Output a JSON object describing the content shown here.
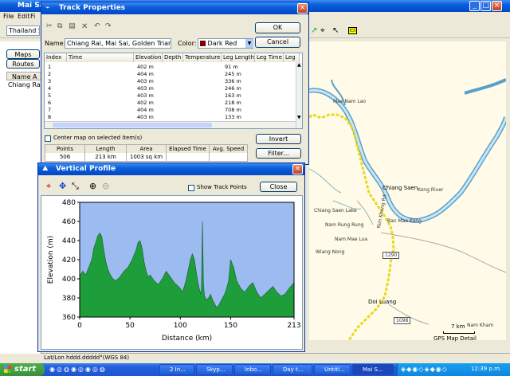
{
  "main_window": {
    "title": "Mai Sai",
    "menu": [
      "File",
      "Edit",
      "Fi"
    ],
    "combo_value": "Thailand St",
    "tabs": [
      "Maps",
      "Routes"
    ],
    "list_header": [
      "Name",
      "A"
    ],
    "list_item": "Chiang Rai",
    "status_latlon": "Lat/Lon hddd.ddddd°(WGS 84)",
    "map_status": "GPS Map Detail",
    "scale": "7 km"
  },
  "map_labels": {
    "chiang_saen": "Chiang Saen",
    "river_road": "Rim Khong Rd",
    "dor_luang": "Doi Luang",
    "road_1098": "1098",
    "road_1290": "1290",
    "lake": "Chiang Saen Lake",
    "place1": "Nam Rung Rung",
    "place2": "Nam Mae Lua",
    "place3": "Wiang Nong",
    "place4": "Ban Mae Kong",
    "place5": "Nam Kham",
    "place6": "Mae Nam Lao",
    "place7": "Kong River"
  },
  "track_properties": {
    "title": "Track Properties",
    "name_label": "Name:",
    "name_value": "Chiang Rai, Mai Sai, Golden Triangle",
    "color_label": "Color:",
    "color_value": "Dark Red",
    "color_swatch": "#800000",
    "ok": "OK",
    "cancel": "Cancel",
    "columns": [
      "Index",
      "Time",
      "Elevation",
      "Depth",
      "Temperature",
      "Leg Length",
      "Leg Time",
      "Leg"
    ],
    "rows": [
      [
        "1",
        "",
        "402 m",
        "",
        "",
        "91 m"
      ],
      [
        "2",
        "",
        "404 m",
        "",
        "",
        "245 m"
      ],
      [
        "3",
        "",
        "403 m",
        "",
        "",
        "336 m"
      ],
      [
        "4",
        "",
        "403 m",
        "",
        "",
        "246 m"
      ],
      [
        "5",
        "",
        "403 m",
        "",
        "",
        "163 m"
      ],
      [
        "6",
        "",
        "402 m",
        "",
        "",
        "218 m"
      ],
      [
        "7",
        "",
        "404 m",
        "",
        "",
        "708 m"
      ],
      [
        "8",
        "",
        "403 m",
        "",
        "",
        "133 m"
      ]
    ],
    "center_map": "Center map on selected item(s)",
    "invert": "Invert",
    "filter": "Filter...",
    "stats_headers": [
      "Points",
      "Length",
      "Area",
      "Elapsed Time",
      "Avg. Speed"
    ],
    "stats_values": [
      "506",
      "213 km",
      "1003 sq km",
      "",
      ""
    ]
  },
  "vertical_profile": {
    "title": "Vertical Profile",
    "show_track_points": "Show Track Points",
    "close": "Close"
  },
  "chart_data": {
    "type": "area",
    "xlabel": "Distance (km)",
    "ylabel": "Elevation (m)",
    "xlim": [
      0,
      213
    ],
    "ylim": [
      360,
      480
    ],
    "x_ticks": [
      0,
      50,
      100,
      150,
      213
    ],
    "y_ticks": [
      360,
      380,
      400,
      420,
      440,
      460,
      480
    ],
    "fill_color": "#1e9e3a",
    "x": [
      0,
      3,
      6,
      9,
      12,
      14,
      16,
      18,
      20,
      22,
      24,
      26,
      28,
      30,
      33,
      36,
      40,
      44,
      48,
      52,
      56,
      58,
      60,
      62,
      64,
      66,
      68,
      70,
      74,
      78,
      82,
      86,
      90,
      94,
      98,
      100,
      102,
      104,
      106,
      108,
      110,
      112,
      114,
      116,
      118,
      120,
      121,
      122,
      123,
      124,
      126,
      128,
      130,
      132,
      134,
      136,
      138,
      140,
      142,
      144,
      146,
      148,
      150,
      153,
      156,
      160,
      164,
      168,
      172,
      176,
      180,
      184,
      188,
      192,
      196,
      200,
      204,
      208,
      213
    ],
    "y": [
      403,
      408,
      404,
      412,
      420,
      432,
      438,
      445,
      448,
      444,
      430,
      418,
      410,
      405,
      400,
      398,
      402,
      408,
      412,
      420,
      430,
      438,
      440,
      432,
      418,
      408,
      402,
      404,
      398,
      394,
      400,
      408,
      402,
      396,
      392,
      390,
      386,
      392,
      400,
      410,
      420,
      426,
      420,
      406,
      394,
      384,
      390,
      460,
      395,
      382,
      378,
      380,
      384,
      378,
      374,
      370,
      372,
      376,
      380,
      384,
      390,
      398,
      420,
      412,
      398,
      390,
      386,
      392,
      396,
      386,
      380,
      384,
      388,
      392,
      386,
      382,
      384,
      390,
      396
    ]
  },
  "taskbar": {
    "start": "start",
    "buttons": [
      "2 In...",
      "Skyp...",
      "Inbo...",
      "Day t...",
      "Untitl...",
      "Mai S..."
    ],
    "clock": "12:39 p.m."
  }
}
